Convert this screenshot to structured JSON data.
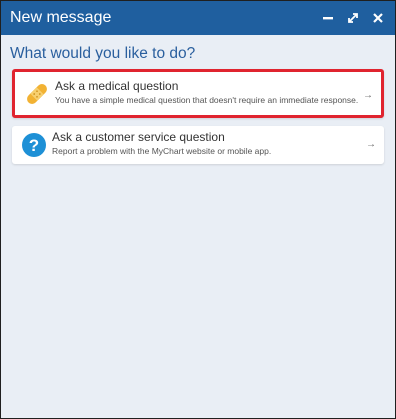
{
  "window": {
    "title": "New message",
    "minimize_icon": "minimize-icon",
    "expand_icon": "expand-icon",
    "close_icon": "close-icon"
  },
  "main": {
    "prompt": "What would you like to do?",
    "options": [
      {
        "title": "Ask a medical question",
        "subtitle": "You have a simple medical question that doesn't require an immediate response.",
        "icon": "bandage-icon",
        "arrow": "→"
      },
      {
        "title": "Ask a customer service question",
        "subtitle": "Report a problem with the MyChart website or mobile app.",
        "icon": "question-icon",
        "arrow": "→"
      }
    ]
  },
  "colors": {
    "titlebar": "#1f5f9f",
    "prompt": "#2a5f9e",
    "highlight": "#e0242f",
    "question_icon": "#1e90d6",
    "bandage": "#f2b233"
  }
}
